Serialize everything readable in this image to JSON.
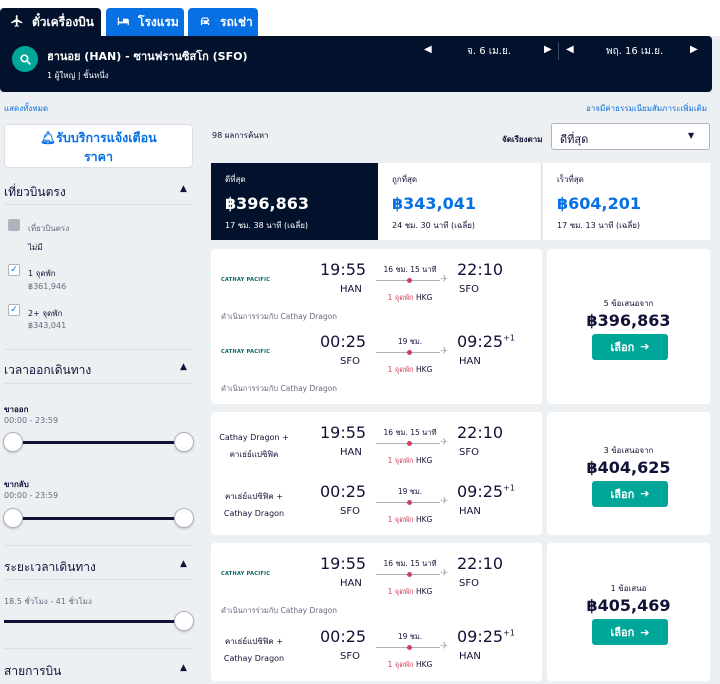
{
  "tabs": [
    {
      "label": "ตั๋วเครื่องบิน",
      "icon": "plane-icon"
    },
    {
      "label": "โรงแรม",
      "icon": "bed-icon"
    },
    {
      "label": "รถเช่า",
      "icon": "car-icon"
    }
  ],
  "search": {
    "route": "ฮานอย (HAN) - ซานฟรานซิสโก (SFO)",
    "passengers": "1 ผู้ใหญ่",
    "cabin": "ชั้นหนึ่ง",
    "depart_date": "จ. 6 เม.ย.",
    "return_date": "พฤ. 16 เม.ย."
  },
  "links": {
    "show_all": "แสดงทั้งหมด",
    "fees": "อาจมีค่าธรรมเนียมสัมภาระเพิ่มเติม"
  },
  "sidebar": {
    "alert_button": "รับบริการแจ้งเตือน\nราคา",
    "stops": {
      "title": "เที่ยวบินตรง",
      "options": [
        {
          "label": "เที่ยวบินตรง",
          "sub": "ไม่มี",
          "checked": false,
          "disabled": true
        },
        {
          "label": "1 จุดพัก",
          "sub": "฿361,946",
          "checked": true,
          "disabled": false
        },
        {
          "label": "2+ จุดพัก",
          "sub": "฿343,041",
          "checked": true,
          "disabled": false
        }
      ]
    },
    "times": {
      "title": "เวลาออกเดินทาง",
      "outbound_label": "ขาออก",
      "outbound_range": "00:00 - 23:59",
      "return_label": "ขากลับ",
      "return_range": "00:00 - 23:59"
    },
    "duration": {
      "title": "ระยะเวลาเดินทาง",
      "range": "18.5 ชั่วโมง - 41 ชั่วโมง"
    },
    "airlines": {
      "title": "สายการบิน"
    }
  },
  "results": {
    "count": "98 ผลการค้นหา",
    "sort_label": "จัดเรียงตาม",
    "sort_value": "ดีที่สุด"
  },
  "summary": [
    {
      "title": "ดีที่สุด",
      "price": "฿396,863",
      "detail": "17 ชม. 38 นาที (เฉลี่ย)"
    },
    {
      "title": "ถูกที่สุด",
      "price": "฿343,041",
      "detail": "24 ชม. 30 นาที (เฉลี่ย)"
    },
    {
      "title": "เร็วที่สุด",
      "price": "฿604,201",
      "detail": "17 ชม. 13 นาที (เฉลี่ย)"
    }
  ],
  "cards": [
    {
      "deals": "5 ข้อเสนอจาก",
      "price": "฿396,863",
      "button": "เลือก",
      "legs": [
        {
          "airline_logo": "CATHAY PACIFIC",
          "dep": "19:55",
          "dep_code": "HAN",
          "arr": "22:10",
          "arr_code": "SFO",
          "arr_plus": "",
          "duration": "16 ชม. 15 นาที",
          "stops": "1 จุดพัก",
          "via": "HKG",
          "note": "ดำเนินการร่วมกับ Cathay Dragon"
        },
        {
          "airline_logo": "CATHAY PACIFIC",
          "dep": "00:25",
          "dep_code": "SFO",
          "arr": "09:25",
          "arr_code": "HAN",
          "arr_plus": "+1",
          "duration": "19 ชม.",
          "stops": "1 จุดพัก",
          "via": "HKG",
          "note": "ดำเนินการร่วมกับ Cathay Dragon"
        }
      ]
    },
    {
      "deals": "3 ข้อเสนอจาก",
      "price": "฿404,625",
      "button": "เลือก",
      "legs": [
        {
          "airline_text": [
            "Cathay Dragon +",
            "คาเธ่ย์แปซิฟิค"
          ],
          "dep": "19:55",
          "dep_code": "HAN",
          "arr": "22:10",
          "arr_code": "SFO",
          "arr_plus": "",
          "duration": "16 ชม. 15 นาที",
          "stops": "1 จุดพัก",
          "via": "HKG"
        },
        {
          "airline_text": [
            "คาเธ่ย์แปซิฟิค +",
            "Cathay Dragon"
          ],
          "dep": "00:25",
          "dep_code": "SFO",
          "arr": "09:25",
          "arr_code": "HAN",
          "arr_plus": "+1",
          "duration": "19 ชม.",
          "stops": "1 จุดพัก",
          "via": "HKG"
        }
      ]
    },
    {
      "deals": "1 ข้อเสนอ",
      "price": "฿405,469",
      "button": "เลือก",
      "legs": [
        {
          "airline_logo": "CATHAY PACIFIC",
          "dep": "19:55",
          "dep_code": "HAN",
          "arr": "22:10",
          "arr_code": "SFO",
          "arr_plus": "",
          "duration": "16 ชม. 15 นาที",
          "stops": "1 จุดพัก",
          "via": "HKG",
          "note": "ดำเนินการร่วมกับ Cathay Dragon"
        },
        {
          "airline_text": [
            "คาเธ่ย์แปซิฟิค +",
            "Cathay Dragon"
          ],
          "dep": "00:25",
          "dep_code": "SFO",
          "arr": "09:25",
          "arr_code": "HAN",
          "arr_plus": "+1",
          "duration": "19 ชม.",
          "stops": "1 จุดพัก",
          "via": "HKG"
        }
      ]
    }
  ]
}
